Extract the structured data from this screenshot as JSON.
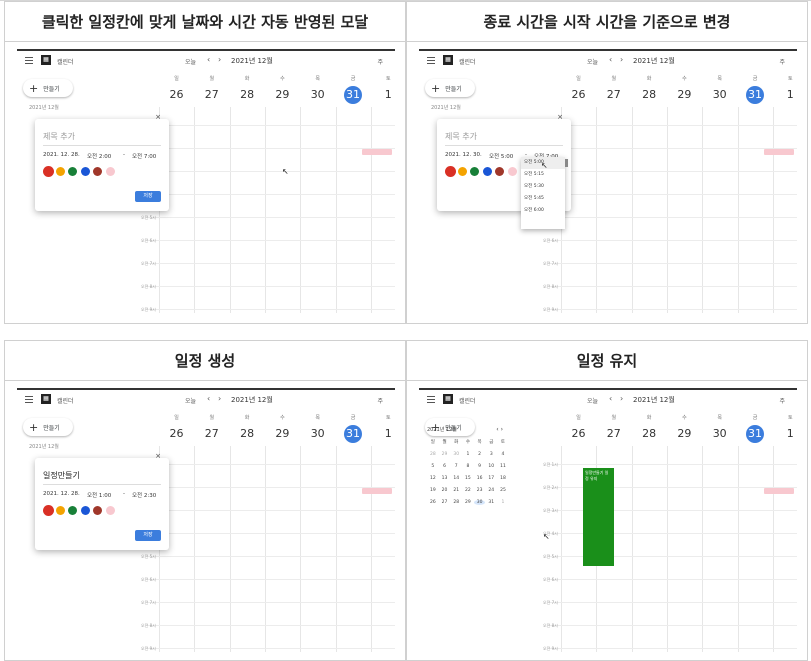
{
  "panels": [
    {
      "caption": "클릭한 일정칸에 맞게 날짜와 시간 자동 반영된 모달",
      "variant": "modal",
      "modal_title": "제목 추가",
      "title_filled": false,
      "modal_date": "2021. 12. 28.",
      "modal_start": "오전 2:00",
      "modal_end": "오전 7:00"
    },
    {
      "caption": "종료 시간을 시작 시간을 기준으로 변경",
      "variant": "dropdown",
      "modal_title": "제목 추가",
      "title_filled": false,
      "modal_date": "2021. 12. 30.",
      "modal_start": "오전 5:00",
      "modal_end": "오전 7:00",
      "dropdown_items": [
        "오전 5:00",
        "오전 5:15",
        "오전 5:30",
        "오전 5:45",
        "오전 6:00"
      ]
    },
    {
      "caption": "일정 생성",
      "variant": "modal",
      "modal_title": "일정만들기",
      "title_filled": true,
      "modal_date": "2021. 12. 28.",
      "modal_start": "오전 1:00",
      "modal_end": "오전 2:30"
    },
    {
      "caption": "일정 유지",
      "variant": "minical",
      "event_title": "일정만들기 일정 유지"
    }
  ],
  "app": {
    "name": "캘린더",
    "today_button": "오늘",
    "month_label": "2021년 12월",
    "view_button": "주",
    "create_button": "만들기",
    "prev_arrow": "‹",
    "next_arrow": "›",
    "mini_label": "2021년 12월"
  },
  "week": {
    "dows": [
      "일",
      "월",
      "화",
      "수",
      "목",
      "금",
      "토"
    ],
    "dates": [
      "26",
      "27",
      "28",
      "29",
      "30",
      "31",
      "1"
    ],
    "today_index": 5
  },
  "time_labels": [
    "오전 1시",
    "오전 2시",
    "오전 3시",
    "오전 4시",
    "오전 5시",
    "오전 6시",
    "오전 7시",
    "오전 8시",
    "오전 9시"
  ],
  "modal_close": "×",
  "save_label": "저장",
  "swatch_colors": [
    "#d93025",
    "#f4a300",
    "#188038",
    "#1a56d6",
    "#a0372a",
    "#f8c8cf"
  ],
  "pink_event_color": "#f8c8cf",
  "green_event_color": "#1a8f1a",
  "accent_color": "#3b7ddd",
  "mini_calendar": {
    "title": "2021년 12월",
    "arrows": "‹ ›",
    "dows": [
      "일",
      "월",
      "화",
      "수",
      "목",
      "금",
      "토"
    ],
    "weeks": [
      [
        "28",
        "29",
        "30",
        "1",
        "2",
        "3",
        "4"
      ],
      [
        "5",
        "6",
        "7",
        "8",
        "9",
        "10",
        "11"
      ],
      [
        "12",
        "13",
        "14",
        "15",
        "16",
        "17",
        "18"
      ],
      [
        "19",
        "20",
        "21",
        "22",
        "23",
        "24",
        "25"
      ],
      [
        "26",
        "27",
        "28",
        "29",
        "30",
        "31",
        "1"
      ]
    ],
    "today_value": "30"
  }
}
